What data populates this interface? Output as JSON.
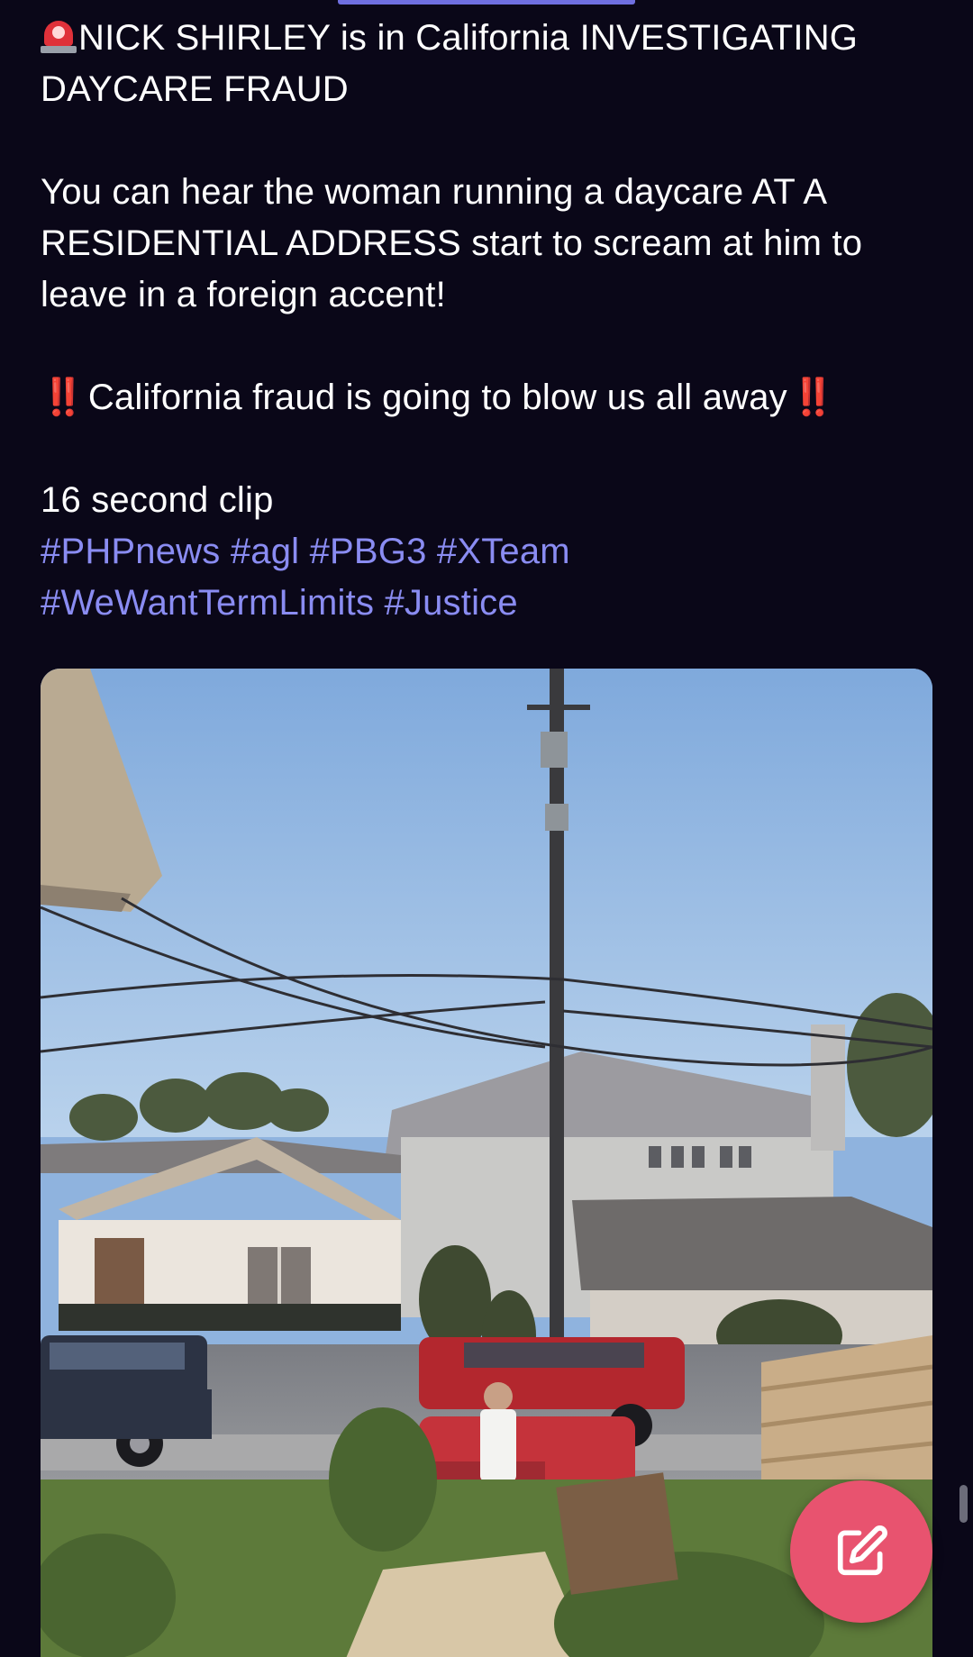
{
  "post": {
    "line1": "NICK SHIRLEY is in California INVESTIGATING DAYCARE FRAUD",
    "line2": "You can hear the woman running a daycare AT A RESIDENTIAL ADDRESS start to scream at him to leave in a foreign accent!",
    "line3": "California fraud is going to blow us all away",
    "line3_emoji": "‼️",
    "line4": "16 second clip",
    "hashtags": [
      "#PHPnews",
      "#agl",
      "#PBG3",
      "#XTeam",
      "#WeWantTermLimits",
      "#Justice"
    ]
  },
  "icons": {
    "siren": "police-light-emoji",
    "compose": "compose-icon"
  },
  "colors": {
    "background": "#0a0718",
    "text": "#ffffff",
    "hashtag": "#8a8cf2",
    "fab": "#e8536f",
    "accent_bar": "#6f6fe0"
  }
}
